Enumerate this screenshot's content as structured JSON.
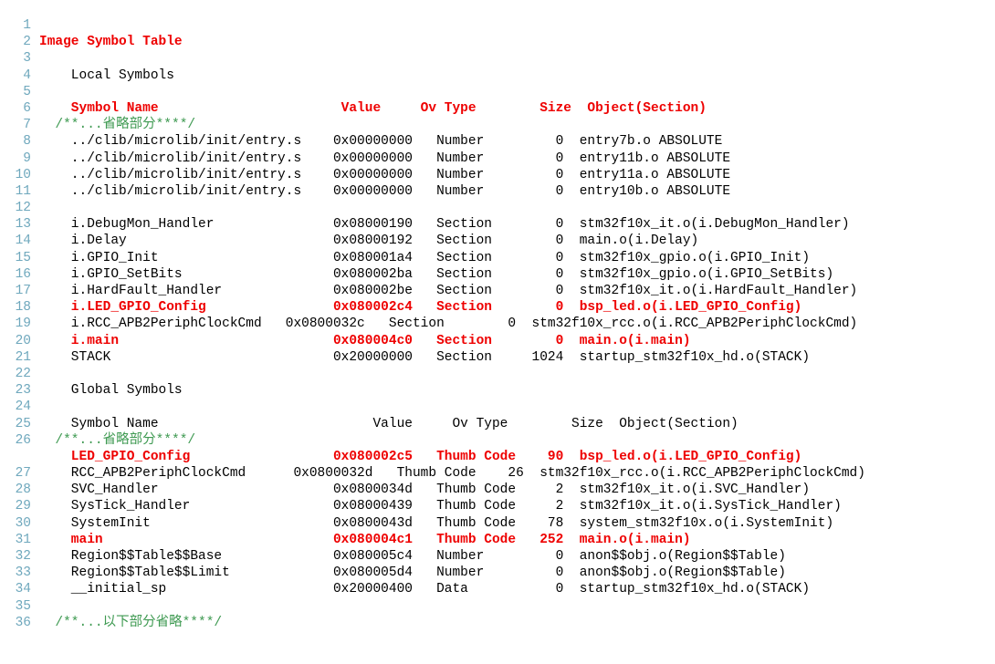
{
  "viewer": {
    "name": "code-block-viewer",
    "language": "plaintext",
    "colors": {
      "background": "#ffffff",
      "line_number": "#6fa8bd",
      "plain_text": "#000000",
      "highlight_red": "#ee0000",
      "comment_green": "#3f9a52"
    }
  },
  "lines": [
    {
      "num": "1",
      "style": "plain",
      "text": ""
    },
    {
      "num": "2",
      "style": "red",
      "text": "Image Symbol Table"
    },
    {
      "num": "3",
      "style": "plain",
      "text": ""
    },
    {
      "num": "4",
      "style": "plain",
      "text": "    Local Symbols"
    },
    {
      "num": "5",
      "style": "plain",
      "text": ""
    },
    {
      "num": "6",
      "style": "red",
      "text": "    Symbol Name                       Value     Ov Type        Size  Object(Section)"
    },
    {
      "num": "7",
      "style": "green",
      "text": "  /**...省略部分****/"
    },
    {
      "num": "8",
      "style": "plain",
      "text": "    ../clib/microlib/init/entry.s    0x00000000   Number         0  entry7b.o ABSOLUTE"
    },
    {
      "num": "9",
      "style": "plain",
      "text": "    ../clib/microlib/init/entry.s    0x00000000   Number         0  entry11b.o ABSOLUTE"
    },
    {
      "num": "10",
      "style": "plain",
      "text": "    ../clib/microlib/init/entry.s    0x00000000   Number         0  entry11a.o ABSOLUTE"
    },
    {
      "num": "11",
      "style": "plain",
      "text": "    ../clib/microlib/init/entry.s    0x00000000   Number         0  entry10b.o ABSOLUTE"
    },
    {
      "num": "12",
      "style": "plain",
      "text": ""
    },
    {
      "num": "13",
      "style": "plain",
      "text": "    i.DebugMon_Handler               0x08000190   Section        0  stm32f10x_it.o(i.DebugMon_Handler)"
    },
    {
      "num": "14",
      "style": "plain",
      "text": "    i.Delay                          0x08000192   Section        0  main.o(i.Delay)"
    },
    {
      "num": "15",
      "style": "plain",
      "text": "    i.GPIO_Init                      0x080001a4   Section        0  stm32f10x_gpio.o(i.GPIO_Init)"
    },
    {
      "num": "16",
      "style": "plain",
      "text": "    i.GPIO_SetBits                   0x080002ba   Section        0  stm32f10x_gpio.o(i.GPIO_SetBits)"
    },
    {
      "num": "17",
      "style": "plain",
      "text": "    i.HardFault_Handler              0x080002be   Section        0  stm32f10x_it.o(i.HardFault_Handler)"
    },
    {
      "num": "18",
      "style": "red",
      "text": "    i.LED_GPIO_Config                0x080002c4   Section        0  bsp_led.o(i.LED_GPIO_Config)"
    },
    {
      "num": "19",
      "style": "plain",
      "text": "    i.RCC_APB2PeriphClockCmd   0x0800032c   Section        0  stm32f10x_rcc.o(i.RCC_APB2PeriphClockCmd)"
    },
    {
      "num": "20",
      "style": "red",
      "text": "    i.main                           0x080004c0   Section        0  main.o(i.main)"
    },
    {
      "num": "21",
      "style": "plain",
      "text": "    STACK                            0x20000000   Section     1024  startup_stm32f10x_hd.o(STACK)"
    },
    {
      "num": "22",
      "style": "plain",
      "text": ""
    },
    {
      "num": "23",
      "style": "plain",
      "text": "    Global Symbols"
    },
    {
      "num": "24",
      "style": "plain",
      "text": ""
    },
    {
      "num": "25",
      "style": "plain",
      "text": "    Symbol Name                           Value     Ov Type        Size  Object(Section)"
    },
    {
      "num": "26",
      "style": "green",
      "text": "  /**...省略部分****/"
    },
    {
      "num": "",
      "style": "red",
      "text": "    LED_GPIO_Config                  0x080002c5   Thumb Code    90  bsp_led.o(i.LED_GPIO_Config)"
    },
    {
      "num": "27",
      "style": "plain",
      "text": "    RCC_APB2PeriphClockCmd      0x0800032d   Thumb Code    26  stm32f10x_rcc.o(i.RCC_APB2PeriphClockCmd)"
    },
    {
      "num": "28",
      "style": "plain",
      "text": "    SVC_Handler                      0x0800034d   Thumb Code     2  stm32f10x_it.o(i.SVC_Handler)"
    },
    {
      "num": "29",
      "style": "plain",
      "text": "    SysTick_Handler                  0x08000439   Thumb Code     2  stm32f10x_it.o(i.SysTick_Handler)"
    },
    {
      "num": "30",
      "style": "plain",
      "text": "    SystemInit                       0x0800043d   Thumb Code    78  system_stm32f10x.o(i.SystemInit)"
    },
    {
      "num": "31",
      "style": "red",
      "text": "    main                             0x080004c1   Thumb Code   252  main.o(i.main)"
    },
    {
      "num": "32",
      "style": "plain",
      "text": "    Region$$Table$$Base              0x080005c4   Number         0  anon$$obj.o(Region$$Table)"
    },
    {
      "num": "33",
      "style": "plain",
      "text": "    Region$$Table$$Limit             0x080005d4   Number         0  anon$$obj.o(Region$$Table)"
    },
    {
      "num": "34",
      "style": "plain",
      "text": "    __initial_sp                     0x20000400   Data           0  startup_stm32f10x_hd.o(STACK)"
    },
    {
      "num": "35",
      "style": "plain",
      "text": ""
    },
    {
      "num": "36",
      "style": "green",
      "text": "  /**...以下部分省略****/"
    }
  ]
}
